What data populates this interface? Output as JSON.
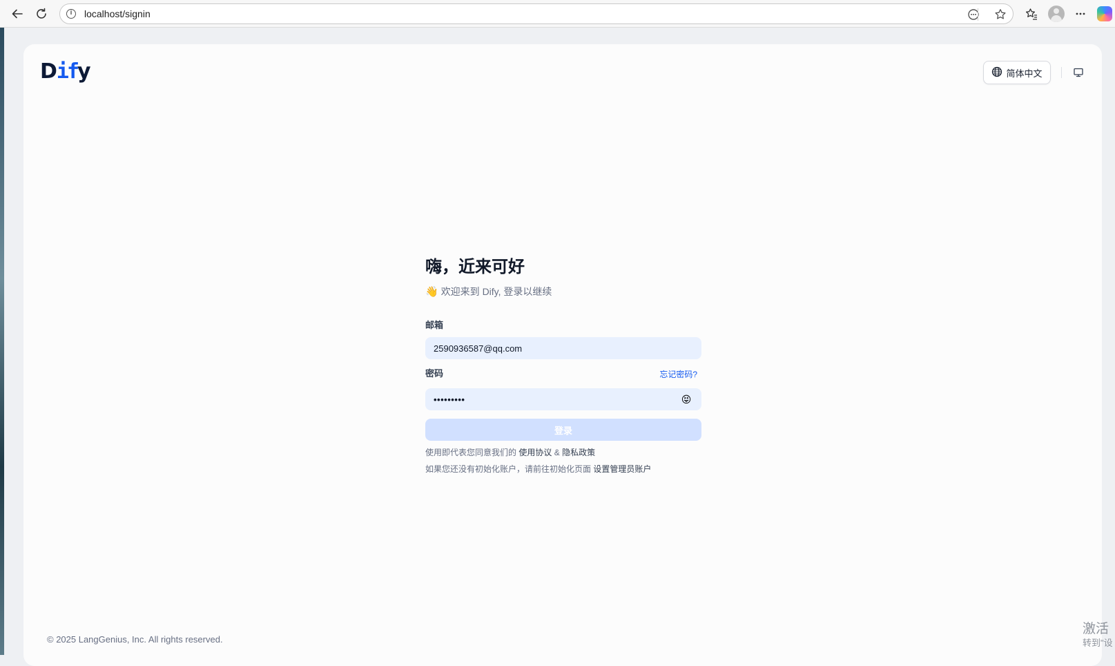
{
  "browser": {
    "url": "localhost/signin"
  },
  "header": {
    "logo": {
      "part1": "D",
      "accent": "if",
      "part2": "y"
    },
    "language_label": "简体中文"
  },
  "signin": {
    "title": "嗨，近来可好",
    "subtitle": "欢迎来到 Dify, 登录以继续",
    "subtitle_icon": "👋",
    "email_label": "邮箱",
    "email_value": "2590936587@qq.com",
    "password_label": "密码",
    "forgot_password": "忘记密码?",
    "password_value": "•••••••••",
    "password_toggle_icon": "😝",
    "submit_label": "登录",
    "terms_prefix": "使用即代表您同意我们的",
    "terms_link": "使用协议",
    "terms_and": "&",
    "privacy_link": "隐私政策",
    "init_prefix": "如果您还没有初始化账户，请前往初始化页面",
    "init_link": "设置管理员账户"
  },
  "footer": {
    "copyright": "© 2025 LangGenius, Inc. All rights reserved."
  },
  "watermark": {
    "line1": "激活",
    "line2": "转到\"设"
  },
  "colors": {
    "accent": "#155aef",
    "input_bg": "#e8f0fe",
    "button_disabled_bg": "#d1e0ff"
  },
  "icons": {
    "back": "back-arrow-icon",
    "reload": "reload-icon",
    "info": "info-icon",
    "reader": "reader-mode-icon",
    "favorite": "star-icon",
    "favorites_bar": "favorites-icon",
    "profile": "profile-icon",
    "more": "more-icon",
    "copilot": "copilot-icon",
    "language": "globe-icon",
    "theme": "monitor-icon"
  }
}
